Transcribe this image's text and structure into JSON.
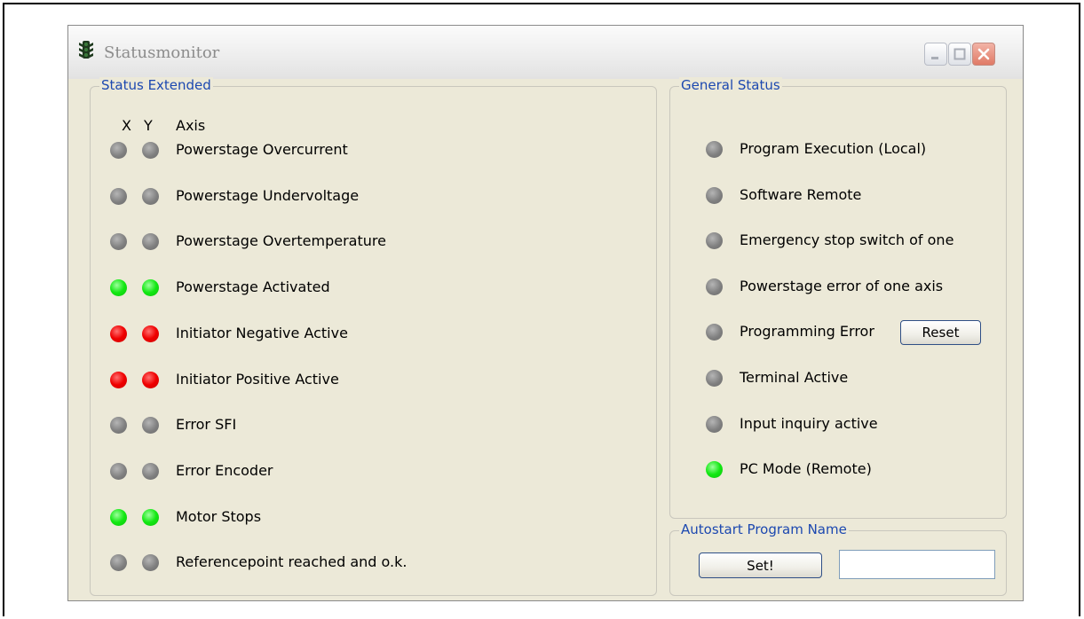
{
  "window": {
    "title": "Statusmonitor",
    "icon": "traffic-light-icon"
  },
  "status_extended": {
    "group_label": "Status Extended",
    "header": {
      "x": "X",
      "y": "Y",
      "axis": "Axis"
    },
    "rows": [
      {
        "label": "Powerstage Overcurrent",
        "x": "gray",
        "y": "gray"
      },
      {
        "label": "Powerstage Undervoltage",
        "x": "gray",
        "y": "gray"
      },
      {
        "label": "Powerstage Overtemperature",
        "x": "gray",
        "y": "gray"
      },
      {
        "label": "Powerstage Activated",
        "x": "green",
        "y": "green"
      },
      {
        "label": "Initiator Negative Active",
        "x": "red",
        "y": "red"
      },
      {
        "label": "Initiator Positive Active",
        "x": "red",
        "y": "red"
      },
      {
        "label": "Error SFI",
        "x": "gray",
        "y": "gray"
      },
      {
        "label": "Error Encoder",
        "x": "gray",
        "y": "gray"
      },
      {
        "label": "Motor Stops",
        "x": "green",
        "y": "green"
      },
      {
        "label": "Referencepoint reached and o.k.",
        "x": "gray",
        "y": "gray"
      }
    ]
  },
  "general_status": {
    "group_label": "General Status",
    "items": [
      {
        "label": "Program Execution (Local)",
        "state": "gray"
      },
      {
        "label": "Software Remote",
        "state": "gray"
      },
      {
        "label": "Emergency stop switch of one",
        "state": "gray"
      },
      {
        "label": "Powerstage error of one axis",
        "state": "gray"
      },
      {
        "label": "Programming Error",
        "state": "gray"
      },
      {
        "label": "Terminal Active",
        "state": "gray"
      },
      {
        "label": "Input inquiry active",
        "state": "gray"
      },
      {
        "label": "PC Mode (Remote)",
        "state": "green"
      }
    ],
    "reset_label": "Reset"
  },
  "autostart": {
    "group_label": "Autostart Program Name",
    "set_label": "Set!",
    "program_name": ""
  },
  "colors": {
    "gray": "#808080",
    "green": "#13e813",
    "red": "#ef0000",
    "group_label": "#1c48b0"
  }
}
